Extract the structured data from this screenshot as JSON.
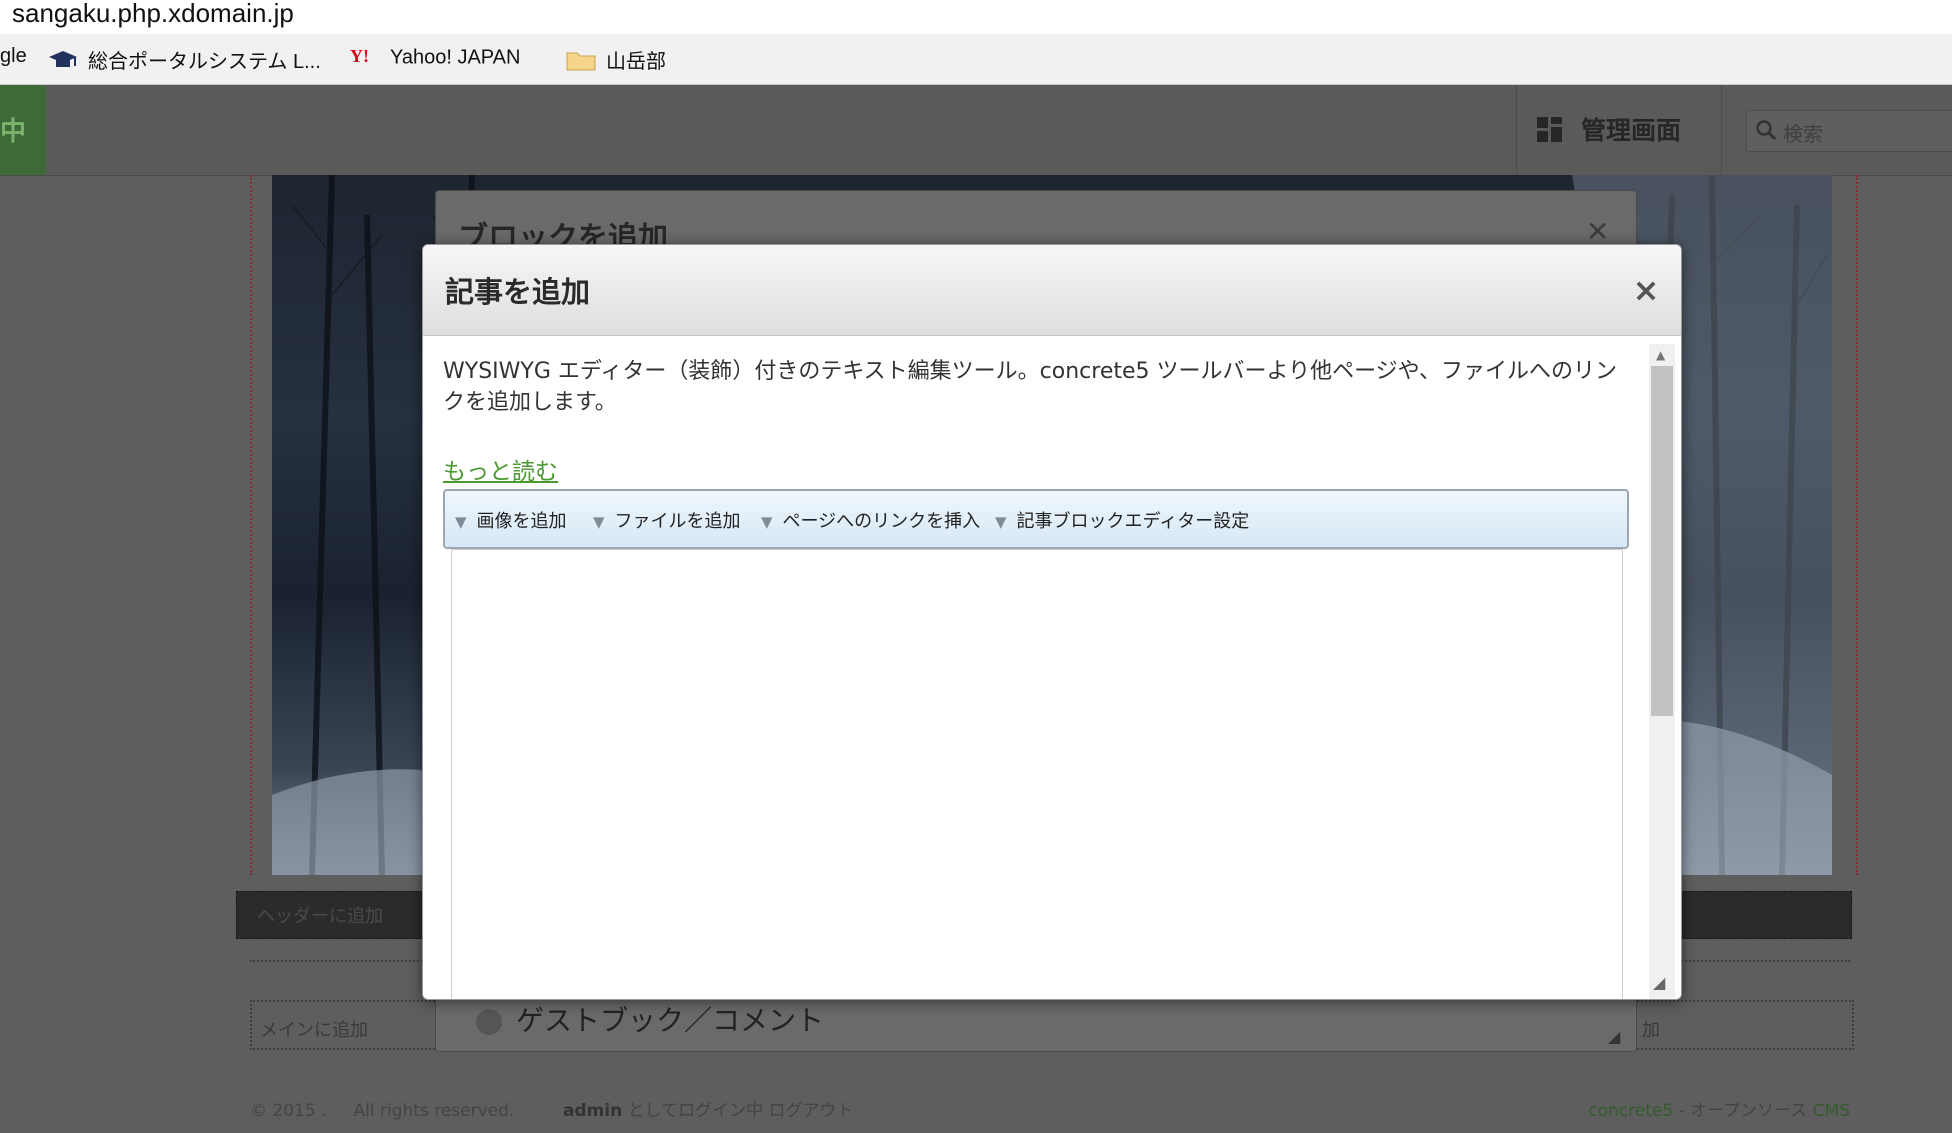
{
  "browser": {
    "url": "sangaku.php.xdomain.jp",
    "bookmarks": [
      {
        "label": "gle",
        "icon": "google-icon"
      },
      {
        "label": "総合ポータルシステム L...",
        "icon": "graduation-cap-icon"
      },
      {
        "label": "Yahoo! JAPAN",
        "icon": "yahoo-icon"
      },
      {
        "label": "山岳部",
        "icon": "folder-icon"
      }
    ]
  },
  "cms_toolbar": {
    "edit_mode_label": "中",
    "admin_label": "管理画面",
    "search_placeholder": "検索"
  },
  "page": {
    "header_add_label": "ヘッダーに追加",
    "main_add_label": "メインに追加",
    "main_add_right": "加",
    "footer": {
      "copyright": "© 2015 .",
      "rights": "All rights reserved.",
      "user": "admin",
      "login_text": "としてログイン中",
      "logout": "ログアウト",
      "brand": "concrete5",
      "brand_suffix": " - オープンソース ",
      "cms": "CMS"
    }
  },
  "background_dialog": {
    "title": "ブロックを追加",
    "item_label": "ゲストブック／コメント"
  },
  "dialog": {
    "title": "記事を追加",
    "description": "WYSIWYG エディター（装飾）付きのテキスト編集ツール。concrete5 ツールバーより他ページや、ファイルへのリンクを追加します。",
    "read_more": "もっと読む",
    "toolbar": {
      "add_image": "画像を追加",
      "add_file": "ファイルを追加",
      "insert_page_link": "ページへのリンクを挿入",
      "editor_settings": "記事ブロックエディター設定"
    }
  },
  "colors": {
    "link_green": "#4a9a30",
    "toolbar_blue": "#d7e8f5",
    "edit_mode_green": "#3e6a38"
  }
}
